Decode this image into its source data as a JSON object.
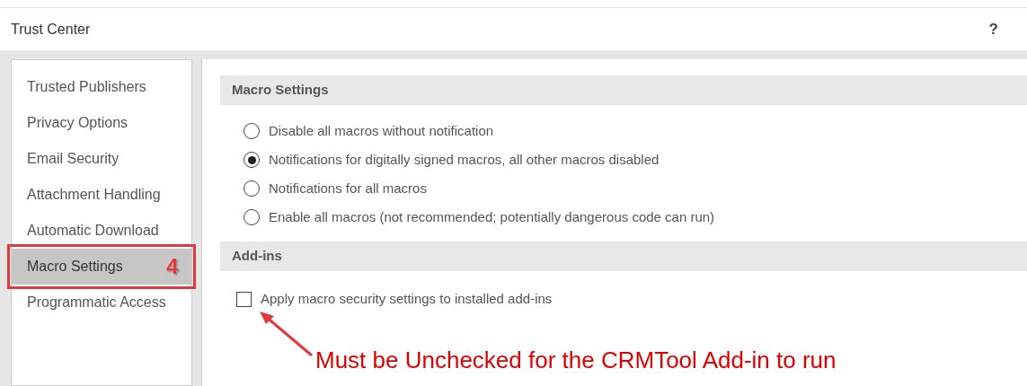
{
  "window": {
    "title": "Trust Center",
    "help": "?"
  },
  "sidebar": {
    "items": [
      {
        "label": "Trusted Publishers",
        "selected": false
      },
      {
        "label": "Privacy Options",
        "selected": false
      },
      {
        "label": "Email Security",
        "selected": false
      },
      {
        "label": "Attachment Handling",
        "selected": false
      },
      {
        "label": "Automatic Download",
        "selected": false
      },
      {
        "label": "Macro Settings",
        "selected": true,
        "callout": "4"
      },
      {
        "label": "Programmatic Access",
        "selected": false
      }
    ]
  },
  "sections": [
    {
      "title": "Macro Settings",
      "options": [
        {
          "kind": "radio",
          "label": "Disable all macros without notification",
          "selected": false
        },
        {
          "kind": "radio",
          "label": "Notifications for digitally signed macros, all other macros disabled",
          "selected": true
        },
        {
          "kind": "radio",
          "label": "Notifications for all macros",
          "selected": false
        },
        {
          "kind": "radio",
          "label": "Enable all macros (not recommended; potentially dangerous code can run)",
          "selected": false
        }
      ]
    },
    {
      "title": "Add-ins",
      "options": [
        {
          "kind": "checkbox",
          "label": "Apply macro security settings to installed add-ins",
          "checked": false
        }
      ]
    }
  ],
  "annotation": {
    "text": "Must be Unchecked for the CRMTool Add-in to run"
  }
}
